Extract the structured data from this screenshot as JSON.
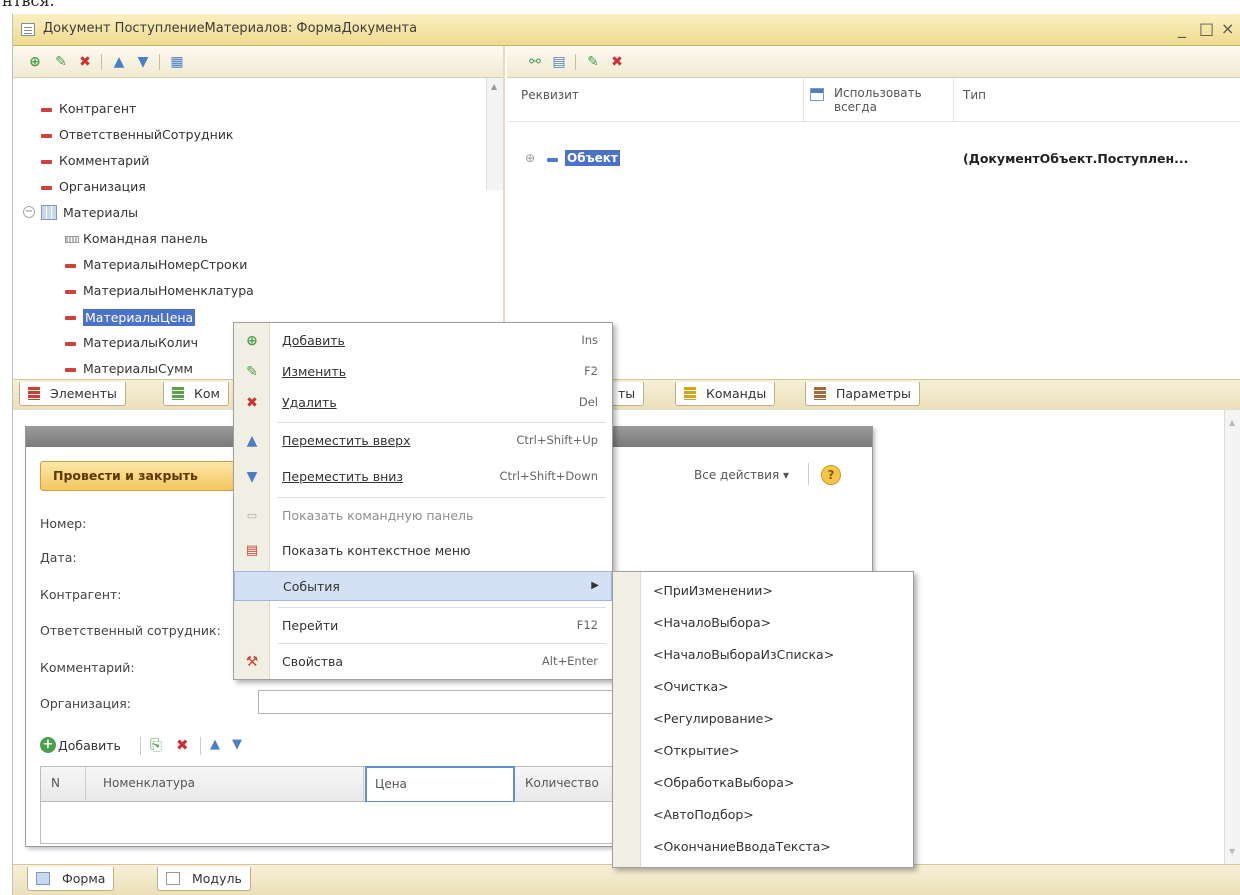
{
  "page_top_text": "нтвся.",
  "window": {
    "title": "Документ ПоступлениеМатериалов: ФормаДокумента",
    "min_glyph": "_",
    "max_glyph": "□",
    "close_glyph": "×"
  },
  "left_tree": {
    "items": [
      {
        "label": "Контрагент",
        "kind": "attribute"
      },
      {
        "label": "ОтветственныйСотрудник",
        "kind": "attribute"
      },
      {
        "label": "Комментарий",
        "kind": "attribute"
      },
      {
        "label": "Организация",
        "kind": "attribute"
      },
      {
        "label": "Материалы",
        "kind": "table",
        "expanded": true
      },
      {
        "label": "Командная панель",
        "kind": "command-panel"
      },
      {
        "label": "МатериалыНомерСтроки",
        "kind": "attribute"
      },
      {
        "label": "МатериалыНоменклатура",
        "kind": "attribute"
      },
      {
        "label": "МатериалыЦена",
        "kind": "attribute",
        "selected": true
      },
      {
        "label": "МатериалыКолич",
        "kind": "attribute"
      },
      {
        "label": "МатериалыСумм",
        "kind": "attribute"
      }
    ]
  },
  "left_tabs": [
    {
      "label": "Элементы",
      "color": "red"
    },
    {
      "label": "Ком",
      "color": "green"
    }
  ],
  "props_table": {
    "col_requisite": "Реквизит",
    "col_use_line1": "Использовать",
    "col_use_line2": "всегда",
    "col_type": "Тип",
    "row": {
      "expander": "⊕",
      "name": "Объект",
      "type": "(ДокументОбъект.Поступлен..."
    }
  },
  "right_tabs": [
    {
      "label": "ты",
      "color": "none"
    },
    {
      "label": "Команды",
      "color": "yellow"
    },
    {
      "label": "Параметры",
      "color": "brown"
    }
  ],
  "form_preview": {
    "post_button": "Провести и закрыть",
    "all_actions": "Все действия ▾",
    "help_glyph": "?",
    "fields": [
      "Номер:",
      "Дата:",
      "Контрагент:",
      "Ответственный сотрудник:",
      "Комментарий:",
      "Организация:"
    ],
    "table_toolbar_add": "Добавить",
    "columns": [
      "N",
      "Номенклатура",
      "Цена",
      "Количество"
    ]
  },
  "context_menu": {
    "items": [
      {
        "label": "Добавить",
        "shortcut": "Ins",
        "icon": "add-icon",
        "underline": true
      },
      {
        "label": "Изменить",
        "shortcut": "F2",
        "icon": "pencil-icon",
        "underline": true
      },
      {
        "label": "Удалить",
        "shortcut": "Del",
        "icon": "delete-icon",
        "underline": true
      },
      {
        "label": "Переместить вверх",
        "shortcut": "Ctrl+Shift+Up",
        "icon": "move-up-icon",
        "underline": true
      },
      {
        "label": "Переместить вниз",
        "shortcut": "Ctrl+Shift+Down",
        "icon": "move-down-icon",
        "underline": true
      },
      {
        "label": "Показать командную панель",
        "shortcut": "",
        "icon": "command-panel-icon",
        "disabled": true
      },
      {
        "label": "Показать контекстное меню",
        "shortcut": "",
        "icon": "context-menu-icon"
      },
      {
        "label": "События",
        "shortcut": "",
        "icon": "",
        "highlighted": true,
        "submenu": true
      },
      {
        "label": "Перейти",
        "shortcut": "F12",
        "icon": ""
      },
      {
        "label": "Свойства",
        "shortcut": "Alt+Enter",
        "icon": "properties-icon"
      }
    ]
  },
  "events_submenu": {
    "items": [
      "<ПриИзменении>",
      "<НачалоВыбора>",
      "<НачалоВыбораИзСписка>",
      "<Очистка>",
      "<Регулирование>",
      "<Открытие>",
      "<ОбработкаВыбора>",
      "<АвтоПодбор>",
      "<ОкончаниеВводаТекста>"
    ]
  },
  "bottom_tabs": [
    {
      "label": "Форма"
    },
    {
      "label": "Модуль"
    }
  ]
}
